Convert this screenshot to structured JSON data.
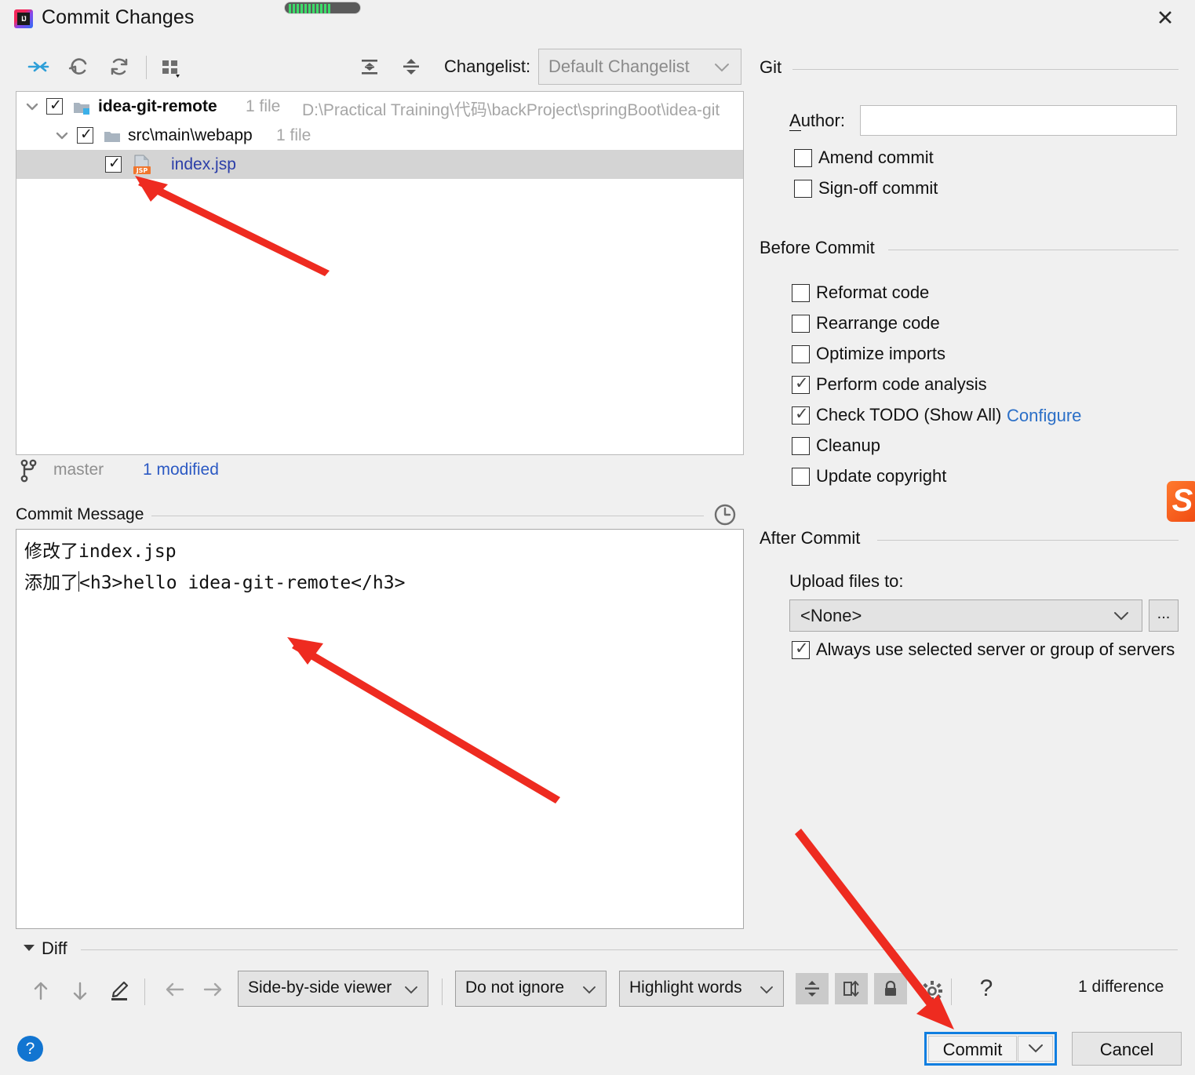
{
  "window": {
    "title": "Commit Changes",
    "app_icon": "intellij-idea-icon",
    "close_label": "✕",
    "recording_indicator": "screen-recording-indicator"
  },
  "toolbar": {
    "icons": [
      {
        "name": "show-diff-icon",
        "title": "Show Diff"
      },
      {
        "name": "revert-icon",
        "title": "Revert"
      },
      {
        "name": "refresh-icon",
        "title": "Refresh"
      },
      {
        "name": "group-by-icon",
        "title": "Group By"
      },
      {
        "name": "expand-all-icon",
        "title": "Expand All"
      },
      {
        "name": "collapse-all-icon",
        "title": "Collapse All"
      }
    ],
    "changelist_label": "Changelist:",
    "changelist_value": "Default Changelist"
  },
  "filetree": {
    "root": {
      "name": "idea-git-remote",
      "count": "1 file",
      "path": "D:\\Practical Training\\代码\\backProject\\springBoot\\idea-git",
      "checked": true,
      "expanded": true
    },
    "folder": {
      "name": "src\\main\\webapp",
      "count": "1 file",
      "checked": true,
      "expanded": true
    },
    "file": {
      "name": "index.jsp",
      "badge": "JSP",
      "checked": true,
      "selected": true
    }
  },
  "branchbar": {
    "branch_icon": "git-branch-icon",
    "branch": "master",
    "modified": "1 modified"
  },
  "commit_message": {
    "label": "Commit Message",
    "history_icon": "clock-history-icon",
    "line1": "修改了index.jsp",
    "line2_before_caret": "添加了",
    "line2_after_caret": "<h3>hello idea-git-remote</h3>"
  },
  "diff": {
    "section_label": "Diff",
    "expanded": true,
    "icons": [
      {
        "name": "previous-difference-icon"
      },
      {
        "name": "next-difference-icon"
      },
      {
        "name": "edit-source-icon"
      },
      {
        "name": "accept-left-icon"
      },
      {
        "name": "accept-right-icon"
      }
    ],
    "viewer_mode": "Side-by-side viewer",
    "ignore_policy": "Do not ignore",
    "highlight_mode": "Highlight words",
    "toggles": [
      {
        "name": "collapse-unchanged-icon",
        "pressed": true
      },
      {
        "name": "synchronize-scrolling-icon",
        "pressed": true
      },
      {
        "name": "read-only-lock-icon",
        "pressed": true
      }
    ],
    "settings_icon": "gear-icon",
    "help_icon": "?",
    "difference_count": "1 difference"
  },
  "git_section": {
    "title": "Git",
    "author_label": "Author:",
    "author_value": "",
    "checkboxes": [
      {
        "label": "Amend commit",
        "checked": false,
        "mnemonic": "m"
      },
      {
        "label": "Sign-off commit",
        "checked": false,
        "mnemonic": "g"
      }
    ]
  },
  "before_commit": {
    "title": "Before Commit",
    "checkboxes": [
      {
        "label": "Reformat code",
        "checked": false
      },
      {
        "label": "Rearrange code",
        "checked": false
      },
      {
        "label": "Optimize imports",
        "checked": false
      },
      {
        "label": "Perform code analysis",
        "checked": true
      },
      {
        "label": "Check TODO (Show All)",
        "checked": true
      },
      {
        "label": "Cleanup",
        "checked": false
      },
      {
        "label": "Update copyright",
        "checked": false
      }
    ],
    "configure_link": "Configure"
  },
  "after_commit": {
    "title": "After Commit",
    "upload_label": "Upload files to:",
    "upload_value": "<None>",
    "more_button": "...",
    "always_use_label": "Always use selected server or group of servers",
    "always_use_checked": true
  },
  "footer": {
    "help": "?",
    "commit_label": "Commit",
    "commit_dropdown": "chevron-down-icon",
    "cancel_label": "Cancel"
  },
  "overlay": {
    "sogou_logo": "S",
    "annotation_color": "#ee2b20",
    "arrows": [
      {
        "name": "arrow-to-file",
        "points_to": "index.jsp"
      },
      {
        "name": "arrow-to-commit-message",
        "points_to": "commit message box"
      },
      {
        "name": "arrow-to-commit-button",
        "points_to": "Commit button"
      }
    ]
  }
}
